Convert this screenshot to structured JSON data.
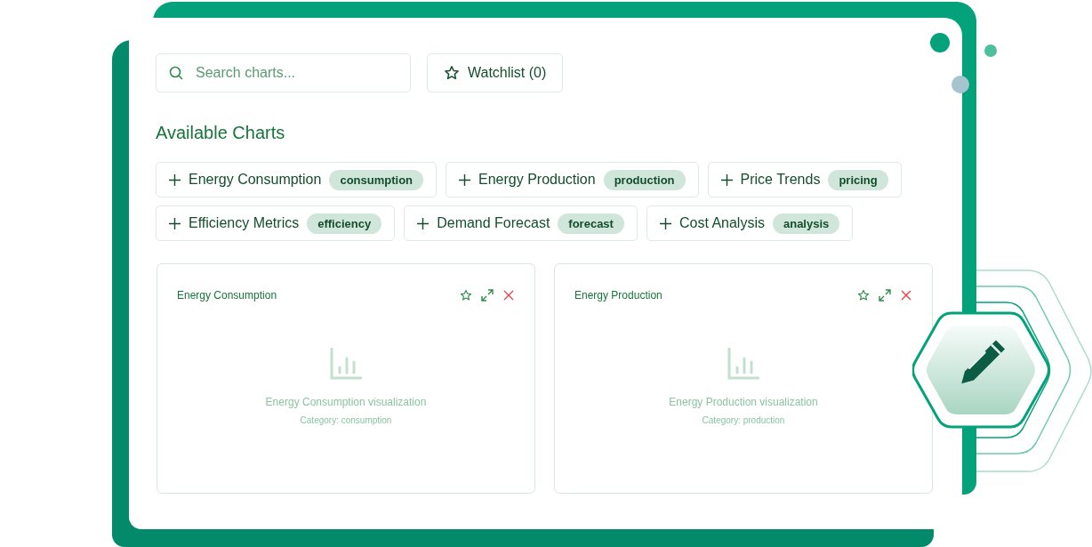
{
  "search": {
    "placeholder": "Search charts..."
  },
  "watchlist_button": {
    "label": "Watchlist (0)"
  },
  "available_charts": {
    "heading": "Available Charts",
    "chips": [
      {
        "label": "Energy Consumption",
        "tag": "consumption"
      },
      {
        "label": "Energy Production",
        "tag": "production"
      },
      {
        "label": "Price Trends",
        "tag": "pricing"
      },
      {
        "label": "Efficiency Metrics",
        "tag": "efficiency"
      },
      {
        "label": "Demand Forecast",
        "tag": "forecast"
      },
      {
        "label": "Cost Analysis",
        "tag": "analysis"
      }
    ]
  },
  "cards": [
    {
      "title": "Energy Consumption",
      "caption": "Energy Consumption visualization",
      "category": "Category: consumption"
    },
    {
      "title": "Energy Production",
      "caption": "Energy Production visualization",
      "category": "Category: production"
    }
  ]
}
